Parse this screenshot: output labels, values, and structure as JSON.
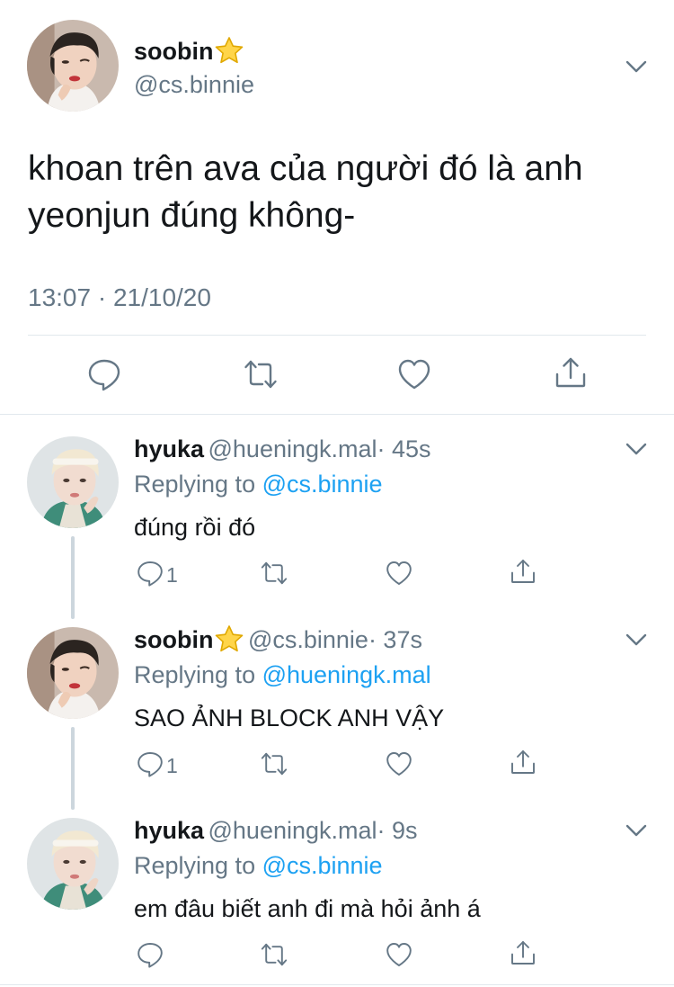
{
  "main_tweet": {
    "display_name": "soobin",
    "handle": "@cs.binnie",
    "text_line1": "khoan trên ava của người đó là anh",
    "text_line2": "yeonjun đúng không-",
    "timestamp": "13:07 · 21/10/20"
  },
  "replies": [
    {
      "display_name": "hyuka",
      "handle": "@hueningk.mal",
      "time": "· 45s",
      "replying_prefix": "Replying to ",
      "replying_to": "@cs.binnie",
      "text": "đúng rồi đó",
      "reply_count": "1"
    },
    {
      "display_name": "soobin",
      "handle": "@cs.binnie",
      "time": "· 37s",
      "replying_prefix": "Replying to ",
      "replying_to": "@hueningk.mal",
      "text": "SAO ẢNH BLOCK ANH VẬY",
      "reply_count": "1"
    },
    {
      "display_name": "hyuka",
      "handle": "@hueningk.mal",
      "time": "· 9s",
      "replying_prefix": "Replying to ",
      "replying_to": "@cs.binnie",
      "text": "em đâu biết anh đi mà hỏi ảnh á",
      "reply_count": ""
    }
  ],
  "icons": {
    "reply": "speech-bubble-icon",
    "retweet": "retweet-icon",
    "like": "heart-icon",
    "share": "share-upload-icon",
    "more": "chevron-down-icon",
    "badge": "star-emoji-icon"
  },
  "colors": {
    "text": "#14171a",
    "secondary": "#657786",
    "link": "#1da1f2",
    "divider": "#e1e8ed"
  }
}
